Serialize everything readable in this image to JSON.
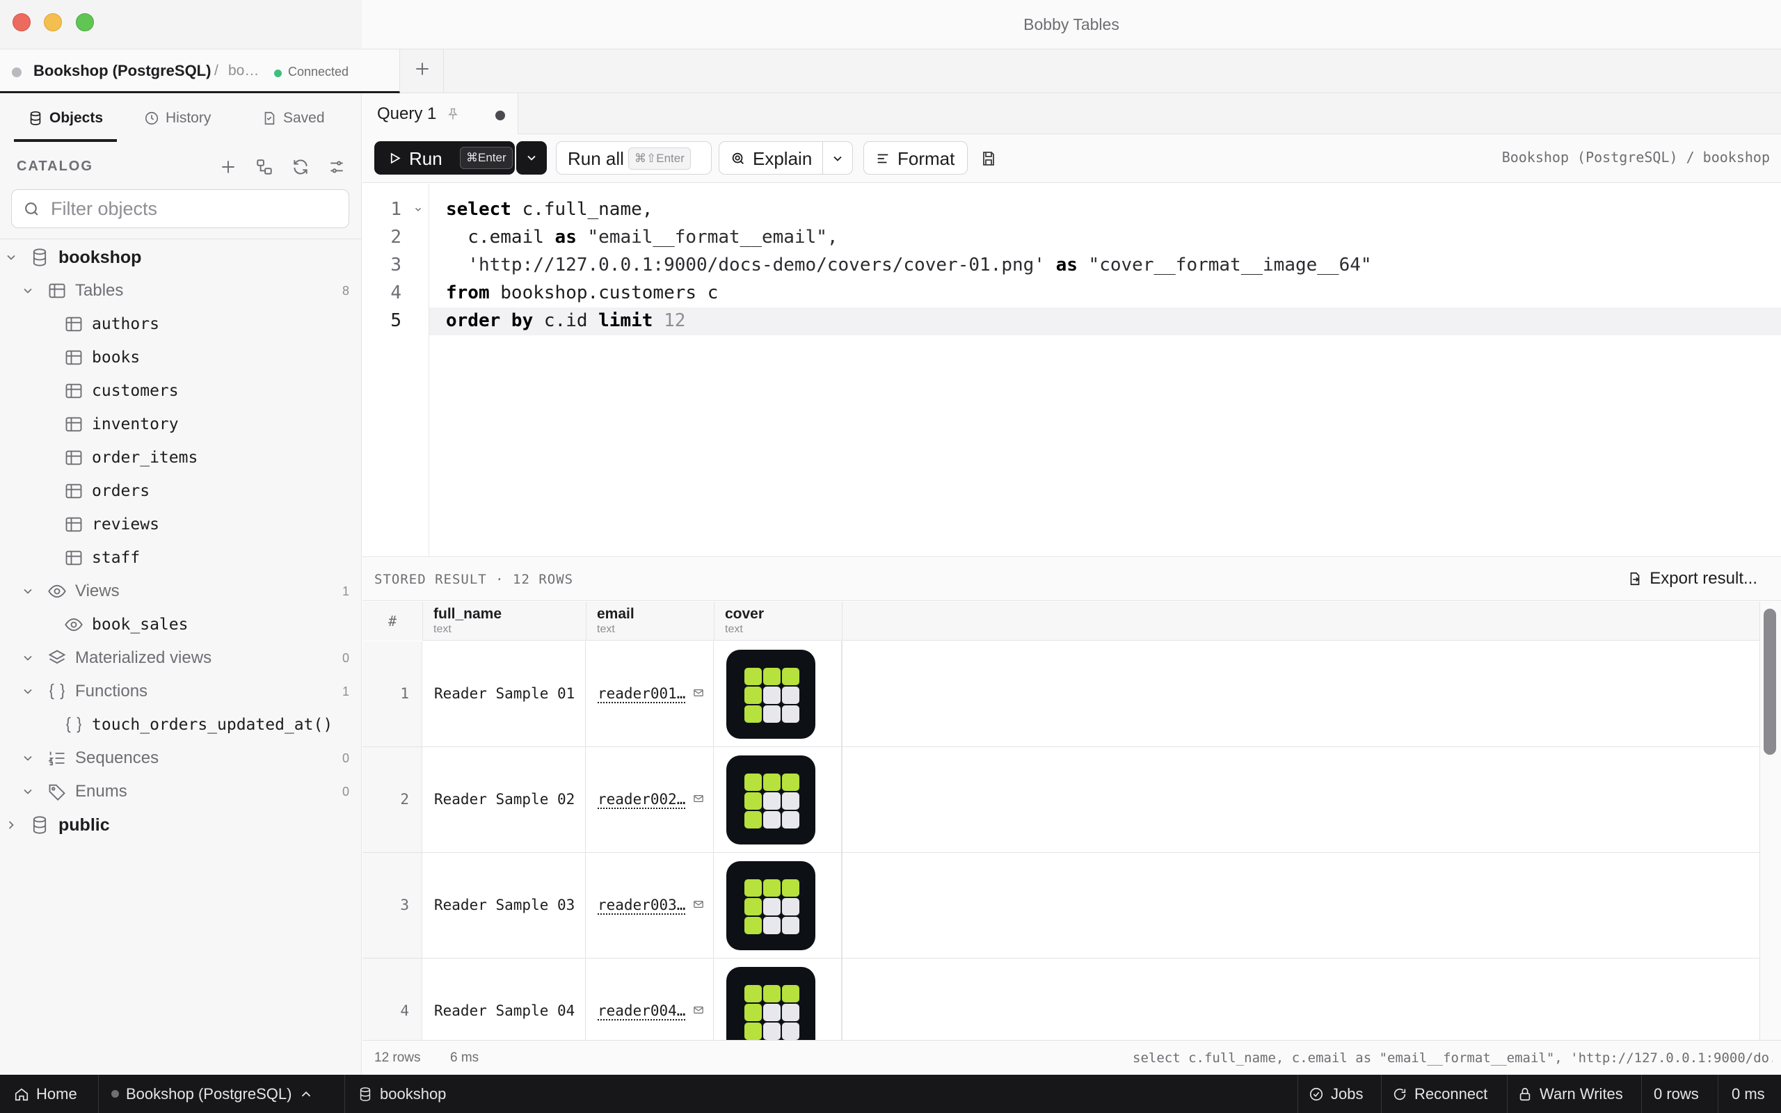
{
  "window": {
    "title": "Bobby Tables"
  },
  "connection_tab": {
    "name": "Bookshop (PostgreSQL)",
    "separator": "/",
    "database": "bo…",
    "status": "Connected",
    "status_color": "#3fbf7f"
  },
  "sidebar": {
    "tabs": [
      {
        "label": "Objects",
        "icon": "database-icon",
        "active": true
      },
      {
        "label": "History",
        "icon": "clock-icon"
      },
      {
        "label": "Saved",
        "icon": "bookmark-file-icon"
      }
    ],
    "catalog_label": "CATALOG",
    "filter_placeholder": "Filter objects",
    "tree": {
      "db": "bookshop",
      "tables_label": "Tables",
      "tables_count": "8",
      "tables": [
        "authors",
        "books",
        "customers",
        "inventory",
        "order_items",
        "orders",
        "reviews",
        "staff"
      ],
      "views_label": "Views",
      "views_count": "1",
      "views": [
        "book_sales"
      ],
      "matviews_label": "Materialized views",
      "matviews_count": "0",
      "functions_label": "Functions",
      "functions_count": "1",
      "functions": [
        "touch_orders_updated_at()"
      ],
      "sequences_label": "Sequences",
      "sequences_count": "0",
      "enums_label": "Enums",
      "enums_count": "0",
      "public_db": "public"
    }
  },
  "query_tab": {
    "label": "Query 1"
  },
  "toolbar": {
    "run_label": "Run",
    "run_shortcut": "⌘Enter",
    "run_all_label": "Run all",
    "run_all_shortcut": "⌘⇧Enter",
    "explain_label": "Explain",
    "format_label": "Format",
    "path": "Bookshop (PostgreSQL) / bookshop"
  },
  "editor": {
    "line_numbers": [
      "1",
      "2",
      "3",
      "4",
      "5"
    ],
    "active_line": "5",
    "lines": {
      "l1_kw": "select",
      "l1_rest": " c.full_name,",
      "l2_a": "  c.email ",
      "l2_kw": "as",
      "l2_str": " \"email__format__email\",",
      "l3_str": "  'http://127.0.0.1:9000/docs-demo/covers/cover-01.png' ",
      "l3_kw": "as",
      "l3_str2": " \"cover__format__image__64\"",
      "l4_kw": "from",
      "l4_rest": " bookshop.customers c",
      "l5_kw1": "order by",
      "l5_mid": " c.id ",
      "l5_kw2": "limit",
      "l5_num": " 12"
    }
  },
  "results": {
    "title": "STORED RESULT · 12 ROWS",
    "export_label": "Export result...",
    "columns": [
      {
        "name": "#",
        "type": ""
      },
      {
        "name": "full_name",
        "type": "text"
      },
      {
        "name": "email",
        "type": "text"
      },
      {
        "name": "cover",
        "type": "text"
      }
    ],
    "rows": [
      {
        "num": "1",
        "full_name": "Reader Sample 01",
        "email": "reader001…"
      },
      {
        "num": "2",
        "full_name": "Reader Sample 02",
        "email": "reader002…"
      },
      {
        "num": "3",
        "full_name": "Reader Sample 03",
        "email": "reader003…"
      },
      {
        "num": "4",
        "full_name": "Reader Sample 04",
        "email": "reader004…"
      }
    ]
  },
  "status_strip": {
    "rows": "12 rows",
    "ms": "6 ms",
    "sql": "select c.full_name, c.email as \"email__format__email\", 'http://127.0.0.1:9000/do..."
  },
  "bottombar": {
    "home": "Home",
    "connection": "Bookshop (PostgreSQL)",
    "database": "bookshop",
    "jobs": "Jobs",
    "reconnect": "Reconnect",
    "warn_writes": "Warn Writes",
    "rows": "0 rows",
    "ms": "0 ms"
  },
  "colors": {
    "accent_dark": "#17171a",
    "cover_green": "#b7e13c"
  }
}
